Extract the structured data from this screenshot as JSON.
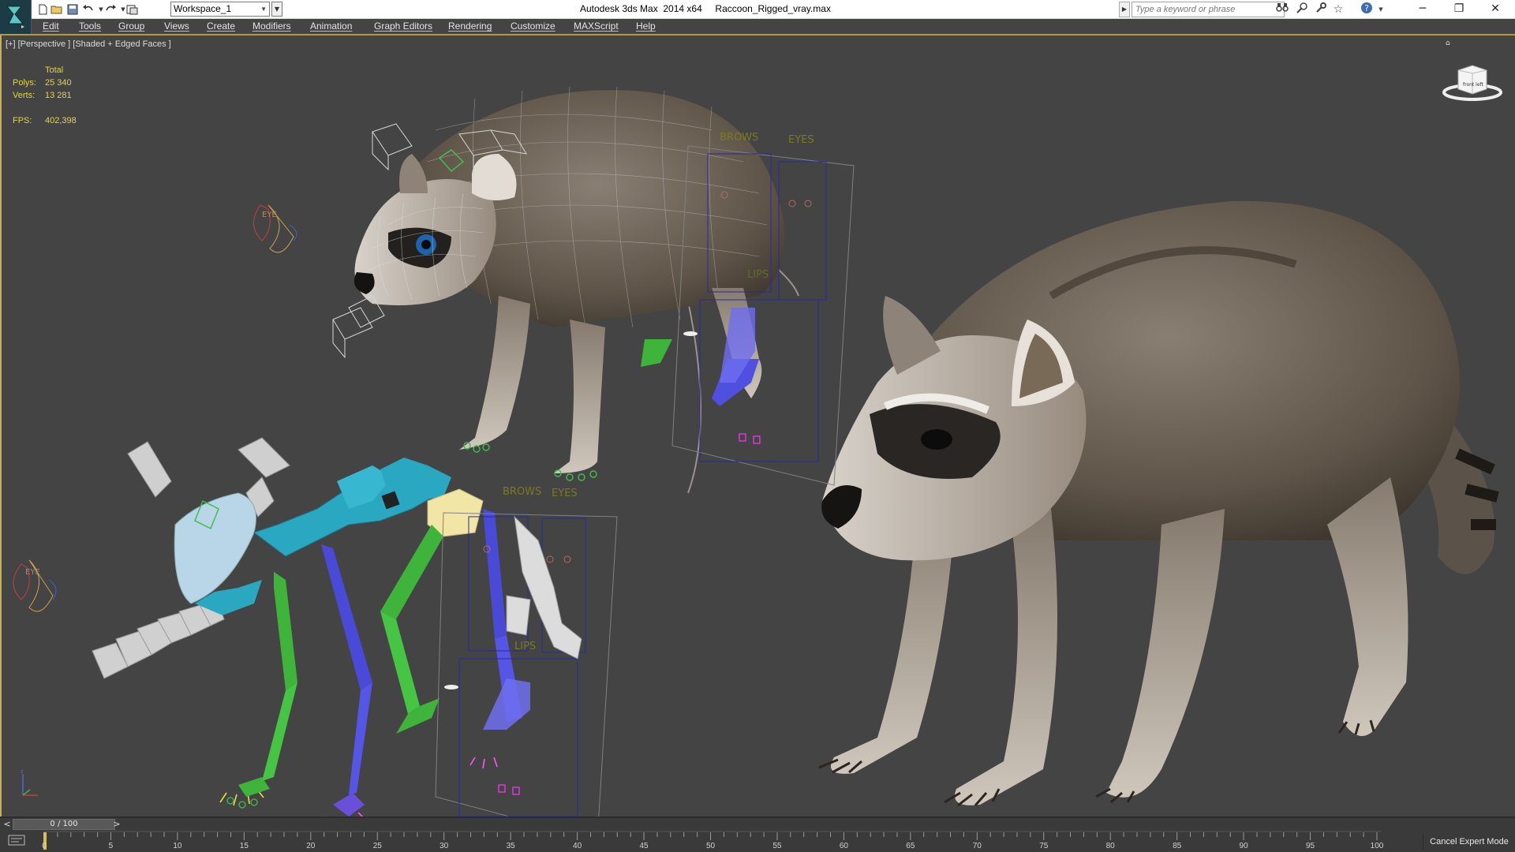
{
  "titlebar": {
    "workspace_value": "Workspace_1",
    "window_title": "Autodesk 3ds Max  2014 x64     Raccoon_Rigged_vray.max",
    "search_placeholder": "Type a keyword or phrase",
    "icons": [
      "new-file-icon",
      "open-file-icon",
      "save-icon",
      "undo-icon",
      "redo-icon",
      "project-folder-icon",
      "binoculars-icon",
      "communication-center-icon",
      "wrench-icon",
      "favorites-icon",
      "help-icon"
    ],
    "window_controls": [
      "minimize",
      "restore",
      "close"
    ]
  },
  "menu": {
    "items": [
      "Edit",
      "Tools",
      "Group",
      "Views",
      "Create",
      "Modifiers",
      "Animation",
      "Graph Editors",
      "Rendering",
      "Customize",
      "MAXScript",
      "Help"
    ]
  },
  "viewport": {
    "label": "[+] [Perspective ] [Shaded + Edged Faces ]",
    "stats": {
      "header": "Total",
      "polys_label": "Polys:",
      "polys_value": "25 340",
      "verts_label": "Verts:",
      "verts_value": "13 281",
      "fps_label": "FPS:",
      "fps_value": "402,398"
    },
    "rig_labels": {
      "brows": "BROWS",
      "eyes": "EYES",
      "lips": "LIPS",
      "eye": "EYE"
    },
    "viewcube_label": "front left"
  },
  "timeline": {
    "slider_text": "0 / 100",
    "prev": "<",
    "next": ">",
    "ticks": [
      "0",
      "5",
      "10",
      "15",
      "20",
      "25",
      "30",
      "35",
      "40",
      "45",
      "50",
      "55",
      "60",
      "65",
      "70",
      "75",
      "80",
      "85",
      "90",
      "95",
      "100"
    ],
    "cancel_expert": "Cancel Expert Mode"
  },
  "colors": {
    "viewport_bg": "#444444",
    "stats_text": "#e2d443",
    "accent_gold": "#c8b14a",
    "spine_cyan": "#2aa8c2",
    "leg_green": "#3fb43a",
    "leg_blue": "#4a4ad8",
    "bone_white": "#b7d4e6"
  }
}
